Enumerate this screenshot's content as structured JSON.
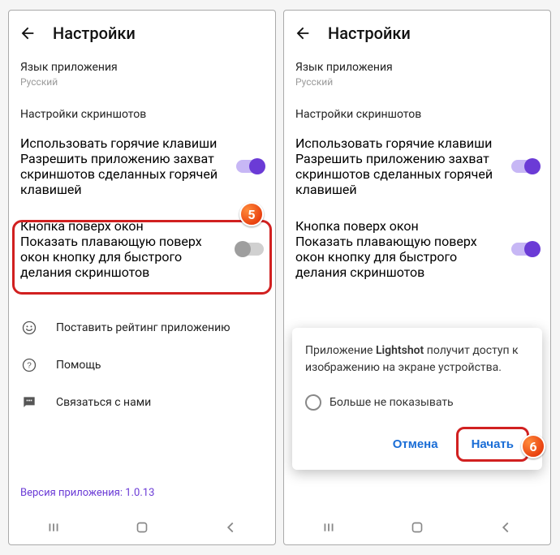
{
  "colors": {
    "accent": "#6b3bd6",
    "danger": "#d12020",
    "link": "#1a6dd6"
  },
  "badges": {
    "five": "5",
    "six": "6"
  },
  "left": {
    "title": "Настройки",
    "lang": {
      "label": "Язык приложения",
      "value": "Русский"
    },
    "screenshots_header": "Настройки скриншотов",
    "hotkeys": {
      "label": "Использовать горячие клавиши",
      "desc": "Разрешить приложению захват скриншотов сделанных горячей клавишей"
    },
    "overlay": {
      "label": "Кнопка поверх окон",
      "desc": "Показать плавающую поверх окон кнопку для быстрого делания скриншотов"
    },
    "rate": "Поставить рейтинг приложению",
    "help": "Помощь",
    "contact": "Связаться с нами",
    "version": "Версия приложения: 1.0.13"
  },
  "right": {
    "title": "Настройки",
    "lang": {
      "label": "Язык приложения",
      "value": "Русский"
    },
    "screenshots_header": "Настройки скриншотов",
    "hotkeys": {
      "label": "Использовать горячие клавиши",
      "desc": "Разрешить приложению захват скриншотов сделанных горячей клавишей"
    },
    "overlay": {
      "label": "Кнопка поверх окон",
      "desc": "Показать плавающую поверх окон кнопку для быстрого делания скриншотов"
    },
    "dialog": {
      "msg_before": "Приложение ",
      "app": "Lightshot",
      "msg_after": " получит доступ к изображению на экране устройства.",
      "dont_show": "Больше не показывать",
      "cancel": "Отмена",
      "start": "Начать"
    }
  }
}
